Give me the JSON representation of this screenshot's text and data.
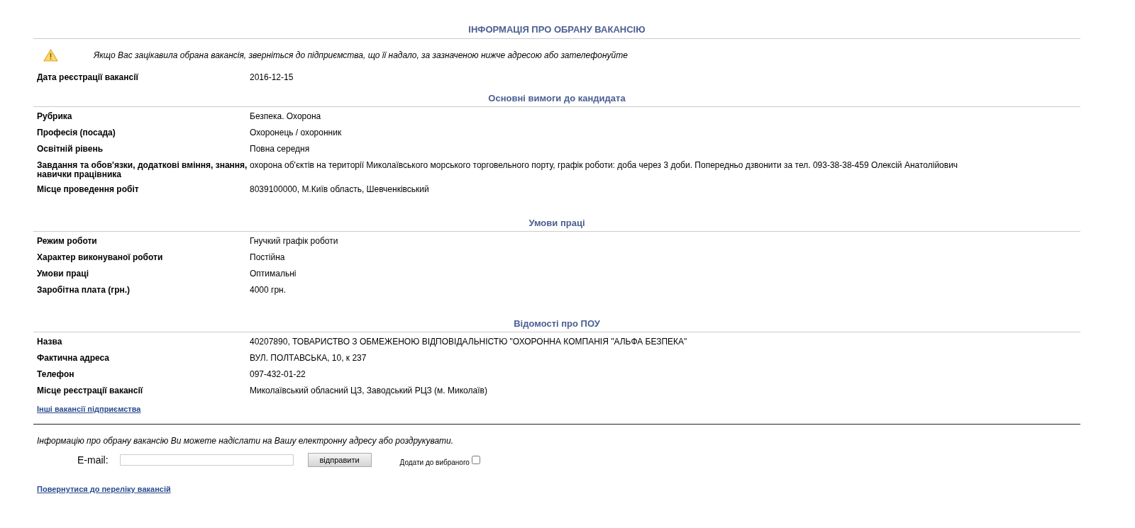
{
  "title": "ІНФОРМАЦІЯ ПРО ОБРАНУ ВАКАНСІЮ",
  "notice": "Якщо Вас зацікавила обрана вакансія, зверніться до підприємства, що її надало, за зазначеною нижче адресою або зателефонуйте",
  "registration": {
    "label": "Дата реєстрації вакансії",
    "value": "2016-12-15"
  },
  "sections": [
    {
      "heading": "Основні вимоги до кандидата",
      "rows": [
        {
          "label": "Рубрика",
          "value": "Безпека. Охорона"
        },
        {
          "label": "Професія (посада)",
          "value": "Охоронець / охоронник"
        },
        {
          "label": "Освітній рівень",
          "value": "Повна середня"
        },
        {
          "label": "Завдання та обов'язки, додаткові вміння, знання, навички працівника",
          "value": "охорона об'єктів на території Миколаївського морського торговельного порту, графік роботи: доба через 3 доби. Попередньо дзвонити за тел. 093-38-38-459 Олексій Анатолійович"
        },
        {
          "label": "Місце проведення робіт",
          "value": "8039100000, М.Київ область, Шевченківський"
        }
      ]
    },
    {
      "heading": "Умови праці",
      "rows": [
        {
          "label": "Режим роботи",
          "value": "Гнучкий графік роботи"
        },
        {
          "label": "Характер виконуваної роботи",
          "value": "Постійна"
        },
        {
          "label": "Умови праці",
          "value": "Оптимальні"
        },
        {
          "label": "Заробітна плата (грн.)",
          "value": "4000 грн."
        }
      ]
    },
    {
      "heading": "Відомості про ПОУ",
      "rows": [
        {
          "label": "Назва",
          "value": "40207890, ТОВАРИСТВО З ОБМЕЖЕНОЮ ВІДПОВІДАЛЬНІСТЮ \"ОХОРОННА КОМПАНІЯ \"АЛЬФА БЕЗПЕКА\""
        },
        {
          "label": "Фактична адреса",
          "value": "ВУЛ. ПОЛТАВСЬКА, 10, к 237"
        },
        {
          "label": "Телефон",
          "value": "097-432-01-22"
        },
        {
          "label": "Місце реєстрації вакансії",
          "value": "Миколаївський обласний ЦЗ, Заводський РЦЗ (м. Миколаїв)"
        }
      ]
    }
  ],
  "other_vacancies_link": "Інші вакансії підприємства",
  "send_form": {
    "note": "Інформацію про обрану вакансію Ви можете надіслати на Вашу електронну адресу або роздрукувати.",
    "email_label": "E-mail:",
    "button": "відправити",
    "favorite_label": "Додати до вибраного",
    "favorite_checked": false
  },
  "back_link": "Повернутися до переліку вакансій"
}
